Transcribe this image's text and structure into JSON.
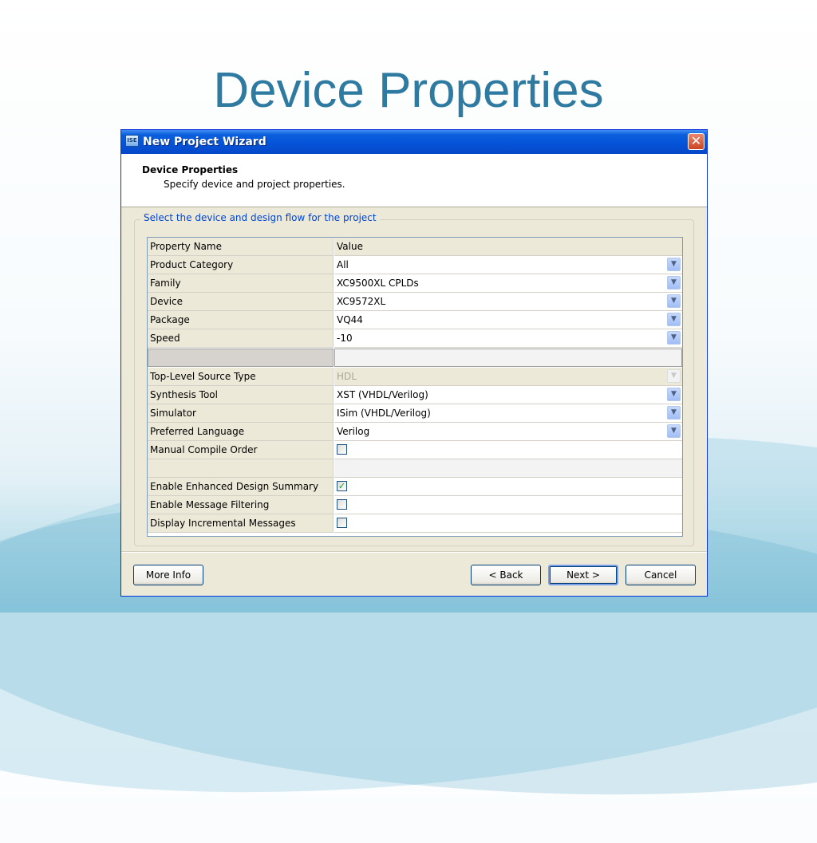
{
  "slide": {
    "title": "Device Properties"
  },
  "window": {
    "title": "New Project Wizard",
    "app_icon_text": "ISE",
    "close_glyph": "✕"
  },
  "header": {
    "title": "Device Properties",
    "subtitle": "Specify device and project properties."
  },
  "group": {
    "legend": "Select the device and design flow for the project"
  },
  "grid": {
    "columns": [
      "Property Name",
      "Value"
    ],
    "rows": [
      {
        "name": "Product Category",
        "value": "All"
      },
      {
        "name": "Family",
        "value": "XC9500XL CPLDs"
      },
      {
        "name": "Device",
        "value": "XC9572XL"
      },
      {
        "name": "Package",
        "value": "VQ44"
      },
      {
        "name": "Speed",
        "value": "-10"
      },
      {
        "name": "",
        "value": ""
      },
      {
        "name": "Top-Level Source Type",
        "value": "HDL"
      },
      {
        "name": "Synthesis Tool",
        "value": "XST (VHDL/Verilog)"
      },
      {
        "name": "Simulator",
        "value": "ISim (VHDL/Verilog)"
      },
      {
        "name": "Preferred Language",
        "value": "Verilog"
      },
      {
        "name": "Manual Compile Order",
        "checked": false
      },
      {
        "name": "",
        "value": ""
      },
      {
        "name": "Enable Enhanced Design Summary",
        "checked": true
      },
      {
        "name": "Enable Message Filtering",
        "checked": false
      },
      {
        "name": "Display Incremental Messages",
        "checked": false
      }
    ],
    "dropdown_glyph": "▼",
    "check_glyph": "✓"
  },
  "buttons": {
    "more_info": "More Info",
    "back": "< Back",
    "next": "Next >",
    "cancel": "Cancel"
  },
  "colors": {
    "title_accent": "#2e7aa1",
    "titlebar": "#0552d8",
    "legend_text": "#0046d5"
  }
}
